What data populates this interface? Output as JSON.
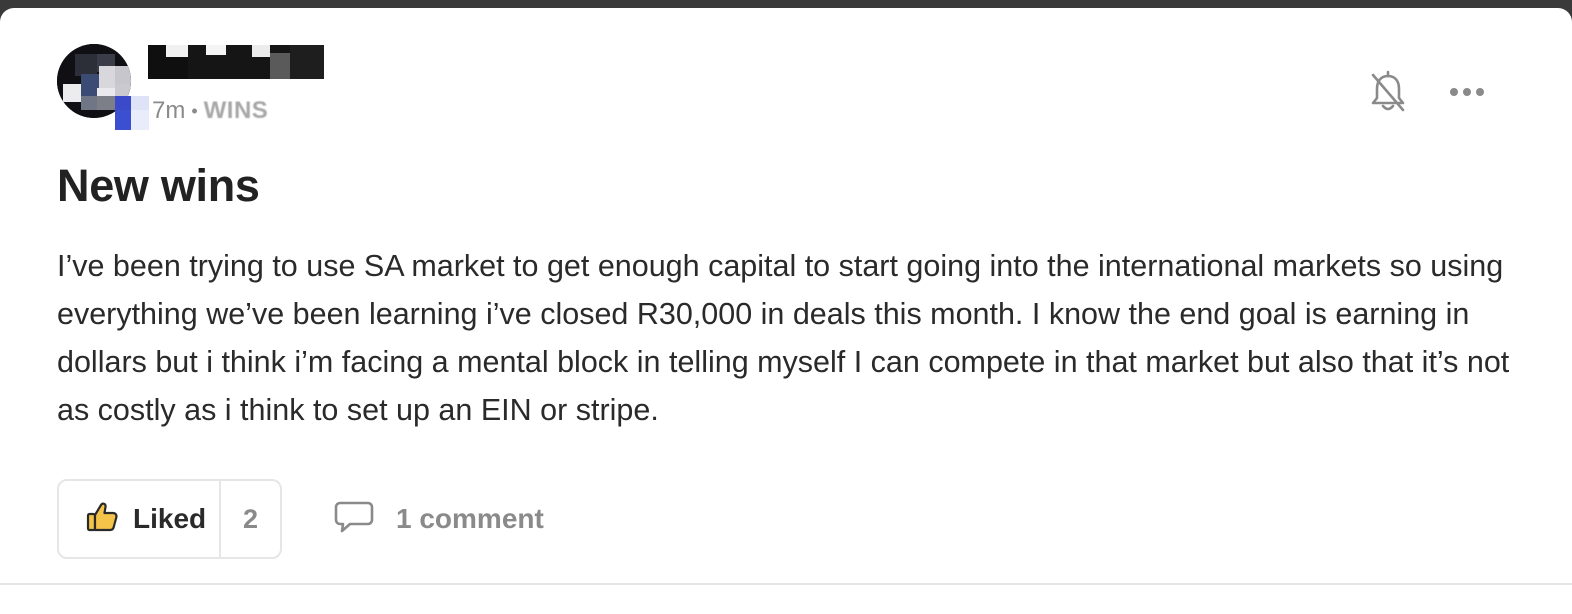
{
  "post": {
    "time": "7m",
    "separator": "•",
    "category": "WINS",
    "title": "New wins",
    "body": "I’ve been trying to use SA market to get enough capital to start going into the international markets so using everything we’ve been learning i’ve closed R30,000 in deals this month. I know the end goal is earning in dollars but i think i’m facing a mental block in telling myself I can compete in that market but also that it’s not as costly as i think to set up an EIN or stripe."
  },
  "actions": {
    "like_label": "Liked",
    "like_count": "2",
    "comment_label": "1 comment"
  },
  "icons": {
    "like": "thumbs-up-icon",
    "comment": "speech-bubble-icon",
    "notifications": "bell-off-icon",
    "more": "more-horizontal-icon"
  },
  "colors": {
    "like_accent": "#f3c34a",
    "text_primary": "#222222",
    "text_muted": "#8a8a8a"
  }
}
